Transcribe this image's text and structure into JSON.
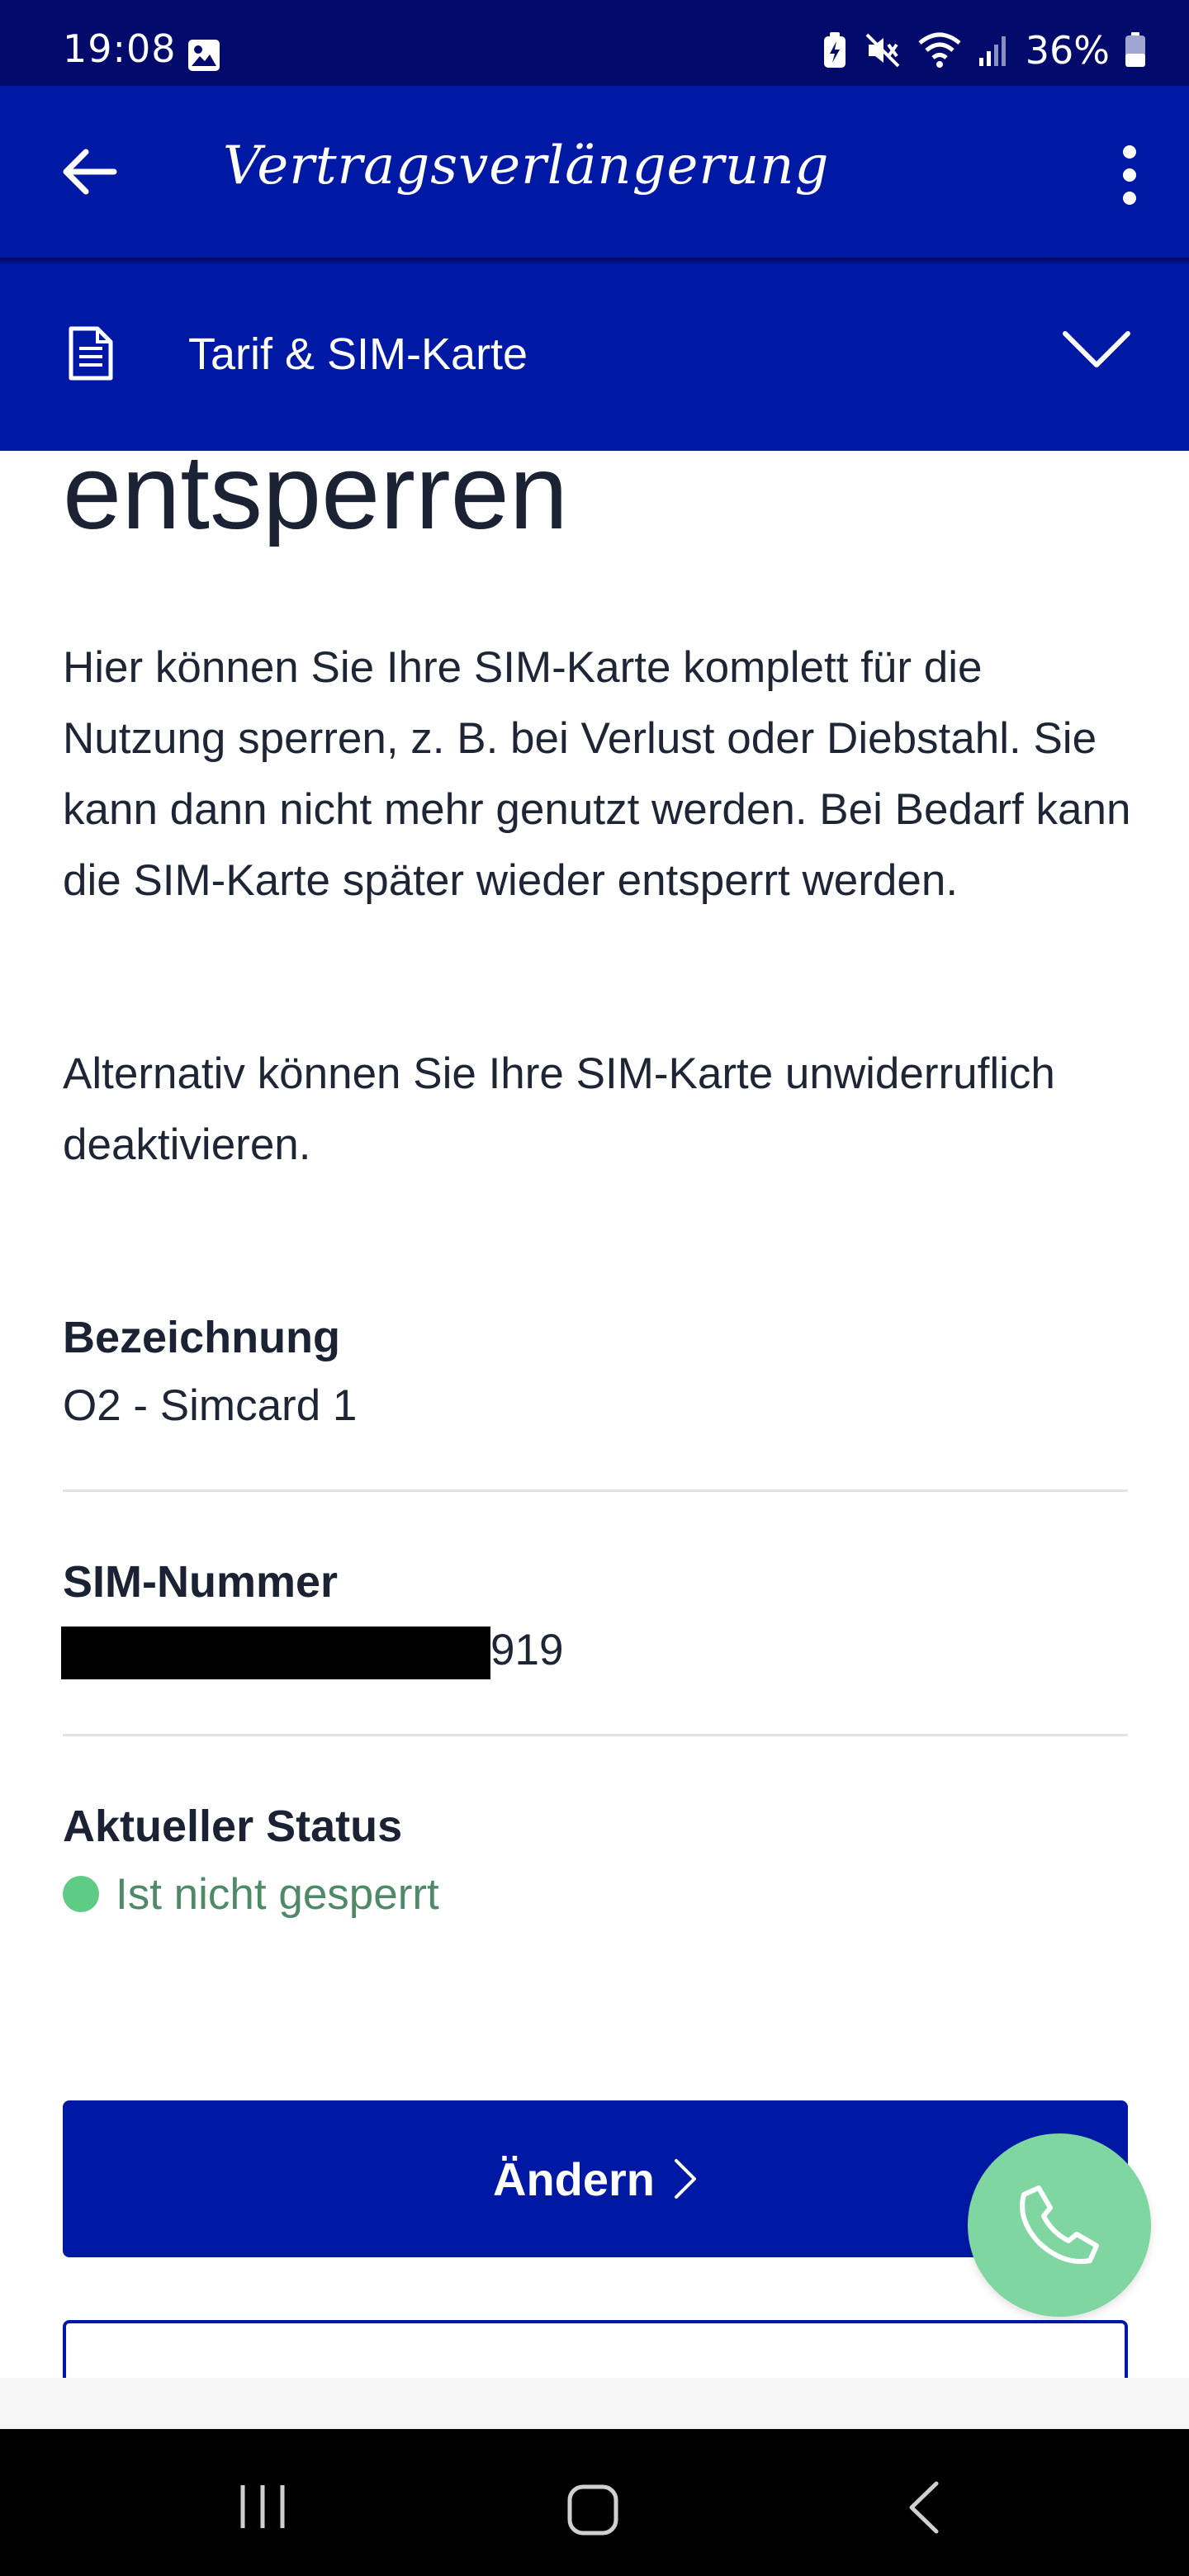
{
  "status_bar": {
    "time": "19:08",
    "battery": "36%"
  },
  "app_bar": {
    "title": "Vertragsverlängerung",
    "back_icon": "arrow-left-icon",
    "more_icon": "more-vertical-icon"
  },
  "section": {
    "label": "Tarif & SIM-Karte",
    "icon": "document-icon",
    "toggle_icon": "chevron-down-icon"
  },
  "content": {
    "heading": "entsperren",
    "paragraph_1": "Hier können Sie Ihre SIM-Karte komplett für die Nutzung sperren, z. B. bei Verlust oder Diebstahl. Sie kann dann nicht mehr genutzt werden. Bei Bedarf kann die SIM-Karte später wieder entsperrt werden.",
    "paragraph_2": "Alternativ können Sie Ihre SIM-Karte unwiderruflich deaktivieren."
  },
  "fields": {
    "name_label": "Bezeichnung",
    "name_value": "O2 - Simcard 1",
    "sim_label": "SIM-Nummer",
    "sim_value_visible": "919",
    "status_label": "Aktueller Status",
    "status_value": "Ist nicht gesperrt"
  },
  "buttons": {
    "change_label": "Ändern"
  },
  "colors": {
    "brand": "#0019a5",
    "status_bar": "#020a6b",
    "status_ok": "#5fcc85",
    "fab": "#7fd6a0"
  }
}
